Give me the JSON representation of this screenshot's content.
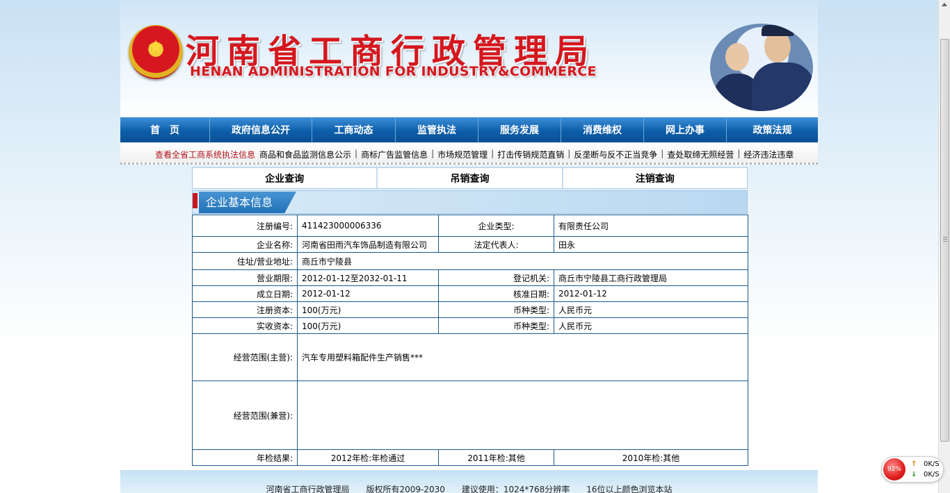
{
  "header": {
    "title_cn": "河南省工商行政管理局",
    "title_en": "HENAN ADMINISTRATION FOR INDUSTRY&COMMERCE"
  },
  "nav": [
    {
      "label": "首　页",
      "name": "nav-home"
    },
    {
      "label": "政府信息公开",
      "name": "nav-gov-info"
    },
    {
      "label": "工商动态",
      "name": "nav-news"
    },
    {
      "label": "监管执法",
      "name": "nav-enforcement"
    },
    {
      "label": "服务发展",
      "name": "nav-service"
    },
    {
      "label": "消费维权",
      "name": "nav-consumer"
    },
    {
      "label": "网上办事",
      "name": "nav-online"
    },
    {
      "label": "政策法规",
      "name": "nav-policy"
    }
  ],
  "subnav": {
    "highlight": "查看全省工商系统执法信息",
    "links": [
      "商品和食品监测信息公示",
      "商标广告监管信息",
      "市场规范管理",
      "打击传销规范直销",
      "反垄断与反不正当竞争",
      "查处取缔无照经营",
      "经济违法违章"
    ]
  },
  "tabs": [
    "企业查询",
    "吊销查询",
    "注销查询"
  ],
  "section_title": "企业基本信息",
  "info": {
    "reg_no_label": "注册编号:",
    "reg_no": "411423000006336",
    "type_label": "企业类型:",
    "type": "有限责任公司",
    "name_label": "企业名称:",
    "name": "河南省田雨汽车饰品制造有限公司",
    "rep_label": "法定代表人:",
    "rep": "田永",
    "addr_label": "住址/营业地址:",
    "addr": "商丘市宁陵县",
    "term_label": "营业期限:",
    "term": "2012-01-12至2032-01-11",
    "authority_label": "登记机关:",
    "authority": "商丘市宁陵县工商行政管理局",
    "founded_label": "成立日期:",
    "founded": "2012-01-12",
    "approved_label": "核准日期:",
    "approved": "2012-01-12",
    "capital_label": "注册资本:",
    "capital": "100(万元)",
    "currency_label": "币种类型:",
    "currency": "人民币元",
    "paid_label": "实收资本:",
    "paid": "100(万元)",
    "currency2_label": "币种类型:",
    "currency2": "人民币元",
    "scope_main_label": "经营范围(主营):",
    "scope_main": "汽车专用塑料箱配件生产销售***",
    "scope_side_label": "经营范围(兼营):",
    "scope_side": "",
    "annual_label": "年检结果:",
    "annual_2012": "2012年检:年检通过",
    "annual_2011": "2011年检:其他",
    "annual_2010": "2010年检:其他"
  },
  "footer": "河南省工商行政管理局　　版权所有2009-2030　　建议使用：1024*768分辨率　　16位以上颜色浏览本站",
  "speed_widget": {
    "percent": "92%",
    "up": "0K/S",
    "down": "0K/S"
  }
}
